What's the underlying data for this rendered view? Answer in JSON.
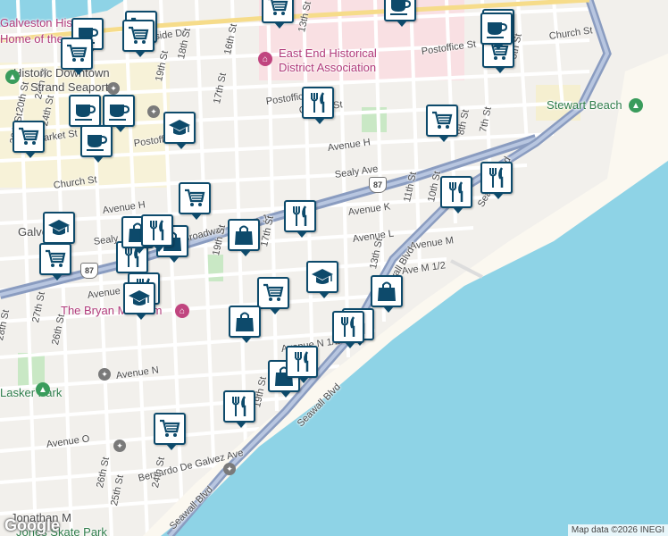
{
  "map": {
    "attribution": "Map data ©2026 INEGI",
    "logo": "Google",
    "street_labels": [
      {
        "text": "Harborside Dr"
      },
      {
        "text": "Postoffice St"
      },
      {
        "text": "Postoffice St"
      },
      {
        "text": "Postoffice St"
      },
      {
        "text": "Church St"
      },
      {
        "text": "Church St"
      },
      {
        "text": "Church St"
      },
      {
        "text": "Market St"
      },
      {
        "text": "Avenue H"
      },
      {
        "text": "Avenue H"
      },
      {
        "text": "Sealy Ave"
      },
      {
        "text": "Sealy"
      },
      {
        "text": "Broadway Avenue J"
      },
      {
        "text": "Avenue K"
      },
      {
        "text": "Avenue L"
      },
      {
        "text": "Avenue M"
      },
      {
        "text": "Ave M 1/2"
      },
      {
        "text": "Avenue L"
      },
      {
        "text": "Avenue N"
      },
      {
        "text": "Avenue N 1/2"
      },
      {
        "text": "Avenue O"
      },
      {
        "text": "Bernardo De Galvez Ave"
      },
      {
        "text": "Seawall Blvd"
      },
      {
        "text": "Seawall Blvd"
      },
      {
        "text": "Seawall Blvd"
      },
      {
        "text": "Seawall Blvd"
      },
      {
        "text": "13th St"
      },
      {
        "text": "18th St"
      },
      {
        "text": "19th St"
      },
      {
        "text": "16th St"
      },
      {
        "text": "17th St"
      },
      {
        "text": "24th St"
      },
      {
        "text": "26th St"
      },
      {
        "text": "20th St"
      },
      {
        "text": "17th St"
      },
      {
        "text": "19th St"
      },
      {
        "text": "13th St"
      },
      {
        "text": "11th St"
      },
      {
        "text": "10th St"
      },
      {
        "text": "8th St"
      },
      {
        "text": "7th St"
      },
      {
        "text": "5th St"
      },
      {
        "text": "28th St"
      },
      {
        "text": "27th St"
      },
      {
        "text": "26th St"
      },
      {
        "text": "24th St"
      },
      {
        "text": "19th St"
      },
      {
        "text": "25th St"
      },
      {
        "text": "26th St"
      },
      {
        "text": "24th St"
      }
    ],
    "place_labels": [
      {
        "text": "Galveston Historic",
        "kind": "poi"
      },
      {
        "text": "Home of the...",
        "kind": "poi"
      },
      {
        "text": "East End Historical",
        "kind": "poi"
      },
      {
        "text": "District Association",
        "kind": "poi"
      },
      {
        "text": "Historic Downtown",
        "kind": "plain"
      },
      {
        "text": "Strand Seaport",
        "kind": "plain"
      },
      {
        "text": "Stewart Beach",
        "kind": "park"
      },
      {
        "text": "Galveston",
        "kind": "plain"
      },
      {
        "text": "The Bryan Museum",
        "kind": "poi"
      },
      {
        "text": "Lasker Park",
        "kind": "park"
      },
      {
        "text": "Jonathan M",
        "kind": "plain"
      },
      {
        "text": "Jones Skate Park",
        "kind": "park"
      }
    ],
    "route_shields": [
      "87",
      "87"
    ],
    "markers": [
      {
        "type": "shopping-cart"
      },
      {
        "type": "shopping-cart"
      },
      {
        "type": "coffee"
      },
      {
        "type": "shopping-cart"
      },
      {
        "type": "coffee"
      },
      {
        "type": "shopping-cart"
      },
      {
        "type": "coffee"
      },
      {
        "type": "coffee"
      },
      {
        "type": "school"
      },
      {
        "type": "shopping-cart"
      },
      {
        "type": "coffee"
      },
      {
        "type": "restaurant"
      },
      {
        "type": "shopping-cart"
      },
      {
        "type": "coffee"
      },
      {
        "type": "shopping-cart"
      },
      {
        "type": "shopping-cart"
      },
      {
        "type": "restaurant"
      },
      {
        "type": "restaurant"
      },
      {
        "type": "restaurant"
      },
      {
        "type": "school"
      },
      {
        "type": "shopping-cart"
      },
      {
        "type": "restaurant"
      },
      {
        "type": "shopping-bag"
      },
      {
        "type": "shopping-bag"
      },
      {
        "type": "shopping-bag"
      },
      {
        "type": "shopping-cart"
      },
      {
        "type": "restaurant"
      },
      {
        "type": "restaurant"
      },
      {
        "type": "school"
      },
      {
        "type": "shopping-bag"
      },
      {
        "type": "shopping-cart"
      },
      {
        "type": "school"
      },
      {
        "type": "shopping-bag"
      },
      {
        "type": "restaurant"
      },
      {
        "type": "restaurant"
      },
      {
        "type": "shopping-bag"
      },
      {
        "type": "restaurant"
      },
      {
        "type": "restaurant"
      },
      {
        "type": "shopping-cart"
      }
    ],
    "colors": {
      "water": "#8ed3e6",
      "land": "#f2f0ec",
      "beach": "#fbf8f0",
      "highway": "#8a9cc0",
      "park": "#c9e8c5",
      "marker_border": "#0d4a6b",
      "downtown": "#f7f2d8",
      "historic": "#f9e0e3"
    }
  }
}
